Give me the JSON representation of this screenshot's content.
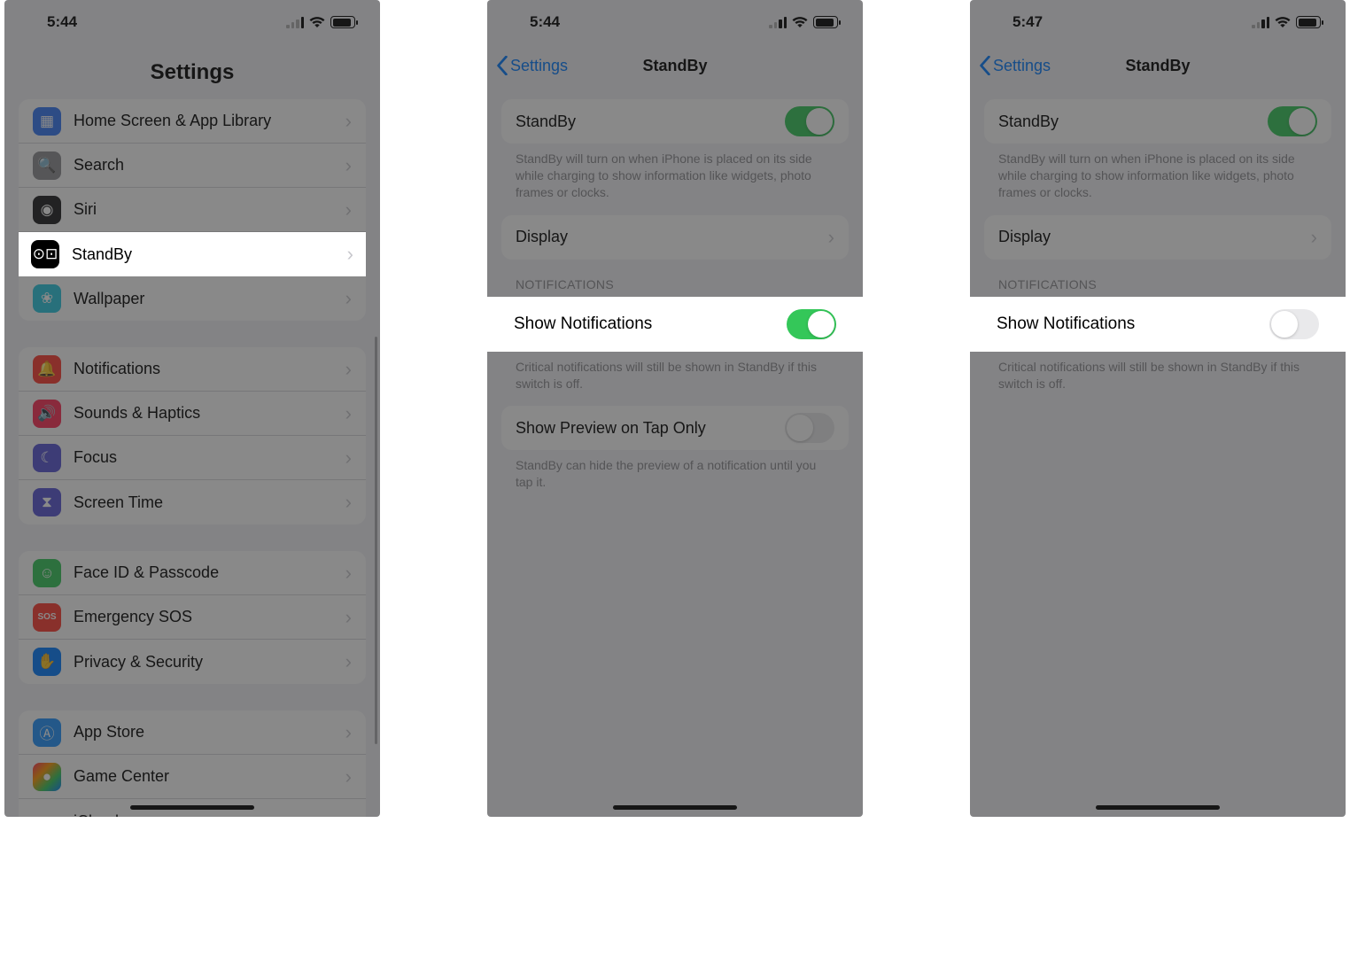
{
  "screens": [
    {
      "time": "5:44",
      "title": "Settings",
      "groups": [
        {
          "rows": [
            {
              "label": "Home Screen & App Library",
              "icon": "home-screen-icon",
              "bg": "#3478f6"
            },
            {
              "label": "Search",
              "icon": "search-icon",
              "bg": "#8e8e93"
            },
            {
              "label": "Siri",
              "icon": "siri-icon",
              "bg": "#1c1c1e"
            },
            {
              "label": "StandBy",
              "icon": "standby-icon",
              "bg": "#000000",
              "highlight": true
            },
            {
              "label": "Wallpaper",
              "icon": "wallpaper-icon",
              "bg": "#28c8e0"
            }
          ]
        },
        {
          "rows": [
            {
              "label": "Notifications",
              "icon": "notifications-icon",
              "bg": "#ff3b30"
            },
            {
              "label": "Sounds & Haptics",
              "icon": "sounds-icon",
              "bg": "#ff2d55"
            },
            {
              "label": "Focus",
              "icon": "focus-icon",
              "bg": "#5856d6"
            },
            {
              "label": "Screen Time",
              "icon": "screen-time-icon",
              "bg": "#5856d6"
            }
          ]
        },
        {
          "rows": [
            {
              "label": "Face ID & Passcode",
              "icon": "faceid-icon",
              "bg": "#34c759"
            },
            {
              "label": "Emergency SOS",
              "icon": "sos-icon",
              "bg": "#ff3b30",
              "text": "SOS"
            },
            {
              "label": "Privacy & Security",
              "icon": "privacy-icon",
              "bg": "#007aff"
            }
          ]
        },
        {
          "rows": [
            {
              "label": "App Store",
              "icon": "appstore-icon",
              "bg": "#1f93ff"
            },
            {
              "label": "Game Center",
              "icon": "gamecenter-icon",
              "bg": "#ffffff"
            },
            {
              "label": "iCloud",
              "icon": "icloud-icon",
              "bg": "#ffffff"
            }
          ]
        }
      ]
    },
    {
      "time": "5:44",
      "back": "Settings",
      "title": "StandBy",
      "standby_label": "StandBy",
      "standby_on": true,
      "standby_desc": "StandBy will turn on when iPhone is placed on its side while charging to show information like widgets, photo frames or clocks.",
      "display_label": "Display",
      "notif_header": "NOTIFICATIONS",
      "show_notif_label": "Show Notifications",
      "show_notif_on": true,
      "show_notif_highlight": true,
      "critical_desc": "Critical notifications will still be shown in StandBy if this switch is off.",
      "preview_label": "Show Preview on Tap Only",
      "preview_on": false,
      "preview_desc": "StandBy can hide the preview of a notification until you tap it."
    },
    {
      "time": "5:47",
      "back": "Settings",
      "title": "StandBy",
      "standby_label": "StandBy",
      "standby_on": true,
      "standby_desc": "StandBy will turn on when iPhone is placed on its side while charging to show information like widgets, photo frames or clocks.",
      "display_label": "Display",
      "notif_header": "NOTIFICATIONS",
      "show_notif_label": "Show Notifications",
      "show_notif_on": false,
      "show_notif_highlight": true,
      "critical_desc": "Critical notifications will still be shown in StandBy if this switch is off."
    }
  ]
}
